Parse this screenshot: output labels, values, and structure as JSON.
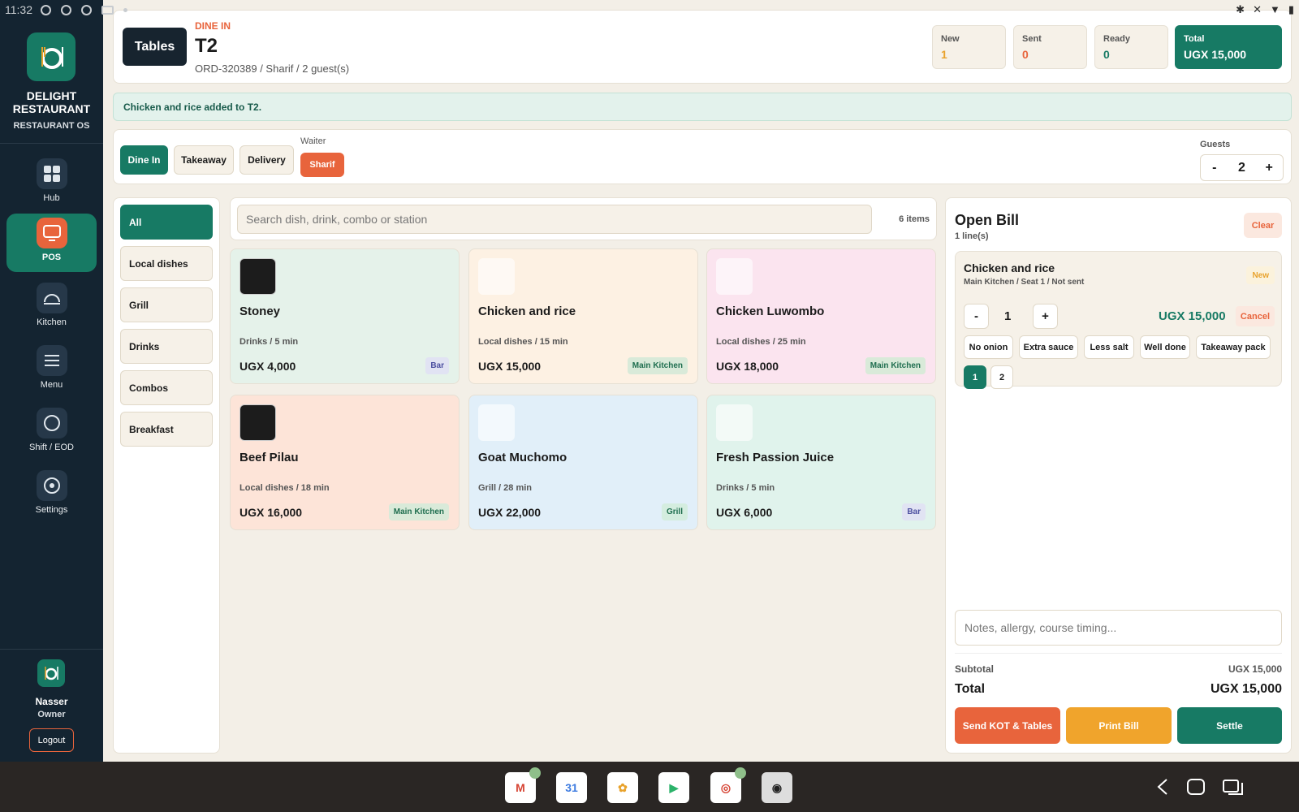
{
  "status_bar": {
    "time": "11:32"
  },
  "sidebar": {
    "brand_line1": "DELIGHT",
    "brand_line2": "RESTAURANT",
    "brand_sub": "RESTAURANT OS",
    "nav": [
      {
        "label": "Hub",
        "icon": "grid-icon"
      },
      {
        "label": "POS",
        "icon": "monitor-icon"
      },
      {
        "label": "Kitchen",
        "icon": "cloche-icon"
      },
      {
        "label": "Menu",
        "icon": "menu-icon"
      },
      {
        "label": "Shift / EOD",
        "icon": "clock-icon"
      },
      {
        "label": "Settings",
        "icon": "gear-icon"
      }
    ],
    "user_name": "Nasser",
    "user_role": "Owner",
    "logout_label": "Logout"
  },
  "header": {
    "tables_label": "Tables",
    "mode": "DINE IN",
    "table": "T2",
    "order_line": "ORD-320389 / Sharif / 2 guest(s)",
    "stats": [
      {
        "label": "New",
        "value": "1",
        "color": "#e8a22c"
      },
      {
        "label": "Sent",
        "value": "0",
        "color": "#e8643c"
      },
      {
        "label": "Ready",
        "value": "0",
        "color": "#177a64"
      },
      {
        "label": "Total",
        "value": "UGX 15,000"
      }
    ]
  },
  "toast": "Chicken and rice added to T2.",
  "order_type": {
    "buttons": [
      "Dine In",
      "Takeaway",
      "Delivery"
    ],
    "waiter_label": "Waiter",
    "waiter": "Sharif",
    "guests_label": "Guests",
    "guests_minus": "-",
    "guests_value": "2",
    "guests_plus": "+"
  },
  "categories": [
    "All",
    "Local dishes",
    "Grill",
    "Drinks",
    "Combos",
    "Breakfast"
  ],
  "search": {
    "placeholder": "Search dish, drink, combo or station",
    "count": "6 items"
  },
  "dishes": [
    {
      "name": "Stoney",
      "meta": "Drinks / 5 min",
      "price": "UGX 4,000",
      "station": "Bar",
      "bg": "#e5f2ea",
      "tag_bg": "#e1e3f3",
      "tag_fg": "#4c4fa0",
      "photo": true
    },
    {
      "name": "Chicken and rice",
      "meta": "Local dishes / 15 min",
      "price": "UGX 15,000",
      "station": "Main Kitchen",
      "bg": "#fdf1e3",
      "tag_bg": "#d9ead9",
      "tag_fg": "#1f6e4f",
      "photo": false
    },
    {
      "name": "Chicken Luwombo",
      "meta": "Local dishes / 25 min",
      "price": "UGX 18,000",
      "station": "Main Kitchen",
      "bg": "#fbe4ef",
      "tag_bg": "#d9ead9",
      "tag_fg": "#1f6e4f",
      "photo": false
    },
    {
      "name": "Beef Pilau",
      "meta": "Local dishes / 18 min",
      "price": "UGX 16,000",
      "station": "Main Kitchen",
      "bg": "#fde4d8",
      "tag_bg": "#d9ead9",
      "tag_fg": "#1f6e4f",
      "photo": true
    },
    {
      "name": "Goat Muchomo",
      "meta": "Grill / 28 min",
      "price": "UGX 22,000",
      "station": "Grill",
      "bg": "#e1eff9",
      "tag_bg": "#d4eddf",
      "tag_fg": "#1f6e4f",
      "photo": false
    },
    {
      "name": "Fresh Passion Juice",
      "meta": "Drinks / 5 min",
      "price": "UGX 6,000",
      "station": "Bar",
      "bg": "#e0f3ec",
      "tag_bg": "#e1e3f3",
      "tag_fg": "#4c4fa0",
      "photo": false
    }
  ],
  "bill": {
    "title": "Open Bill",
    "lines": "1 line(s)",
    "clear": "Clear",
    "item": {
      "name": "Chicken and rice",
      "meta": "Main Kitchen / Seat 1 / Not sent",
      "badge": "New",
      "minus": "-",
      "qty": "1",
      "plus": "+",
      "price": "UGX 15,000",
      "cancel": "Cancel",
      "modifiers": [
        "No onion",
        "Extra sauce",
        "Less salt",
        "Well done",
        "Takeaway pack"
      ],
      "seats": [
        "1",
        "2"
      ]
    },
    "notes_placeholder": "Notes, allergy, course timing...",
    "subtotal_label": "Subtotal",
    "subtotal": "UGX 15,000",
    "total_label": "Total",
    "total": "UGX 15,000",
    "actions": [
      {
        "label": "Send KOT & Tables",
        "color": "#e8643c"
      },
      {
        "label": "Print Bill",
        "color": "#f0a42c"
      },
      {
        "label": "Settle",
        "color": "#177a64"
      }
    ]
  },
  "taskbar": {
    "apps": [
      {
        "name": "gmail-icon",
        "glyph": "M"
      },
      {
        "name": "calendar-icon",
        "glyph": "31"
      },
      {
        "name": "photos-icon",
        "glyph": "✿"
      },
      {
        "name": "play-store-icon",
        "glyph": "▶"
      },
      {
        "name": "chrome-icon",
        "glyph": "◎"
      },
      {
        "name": "camera-icon",
        "glyph": "◉"
      }
    ]
  }
}
